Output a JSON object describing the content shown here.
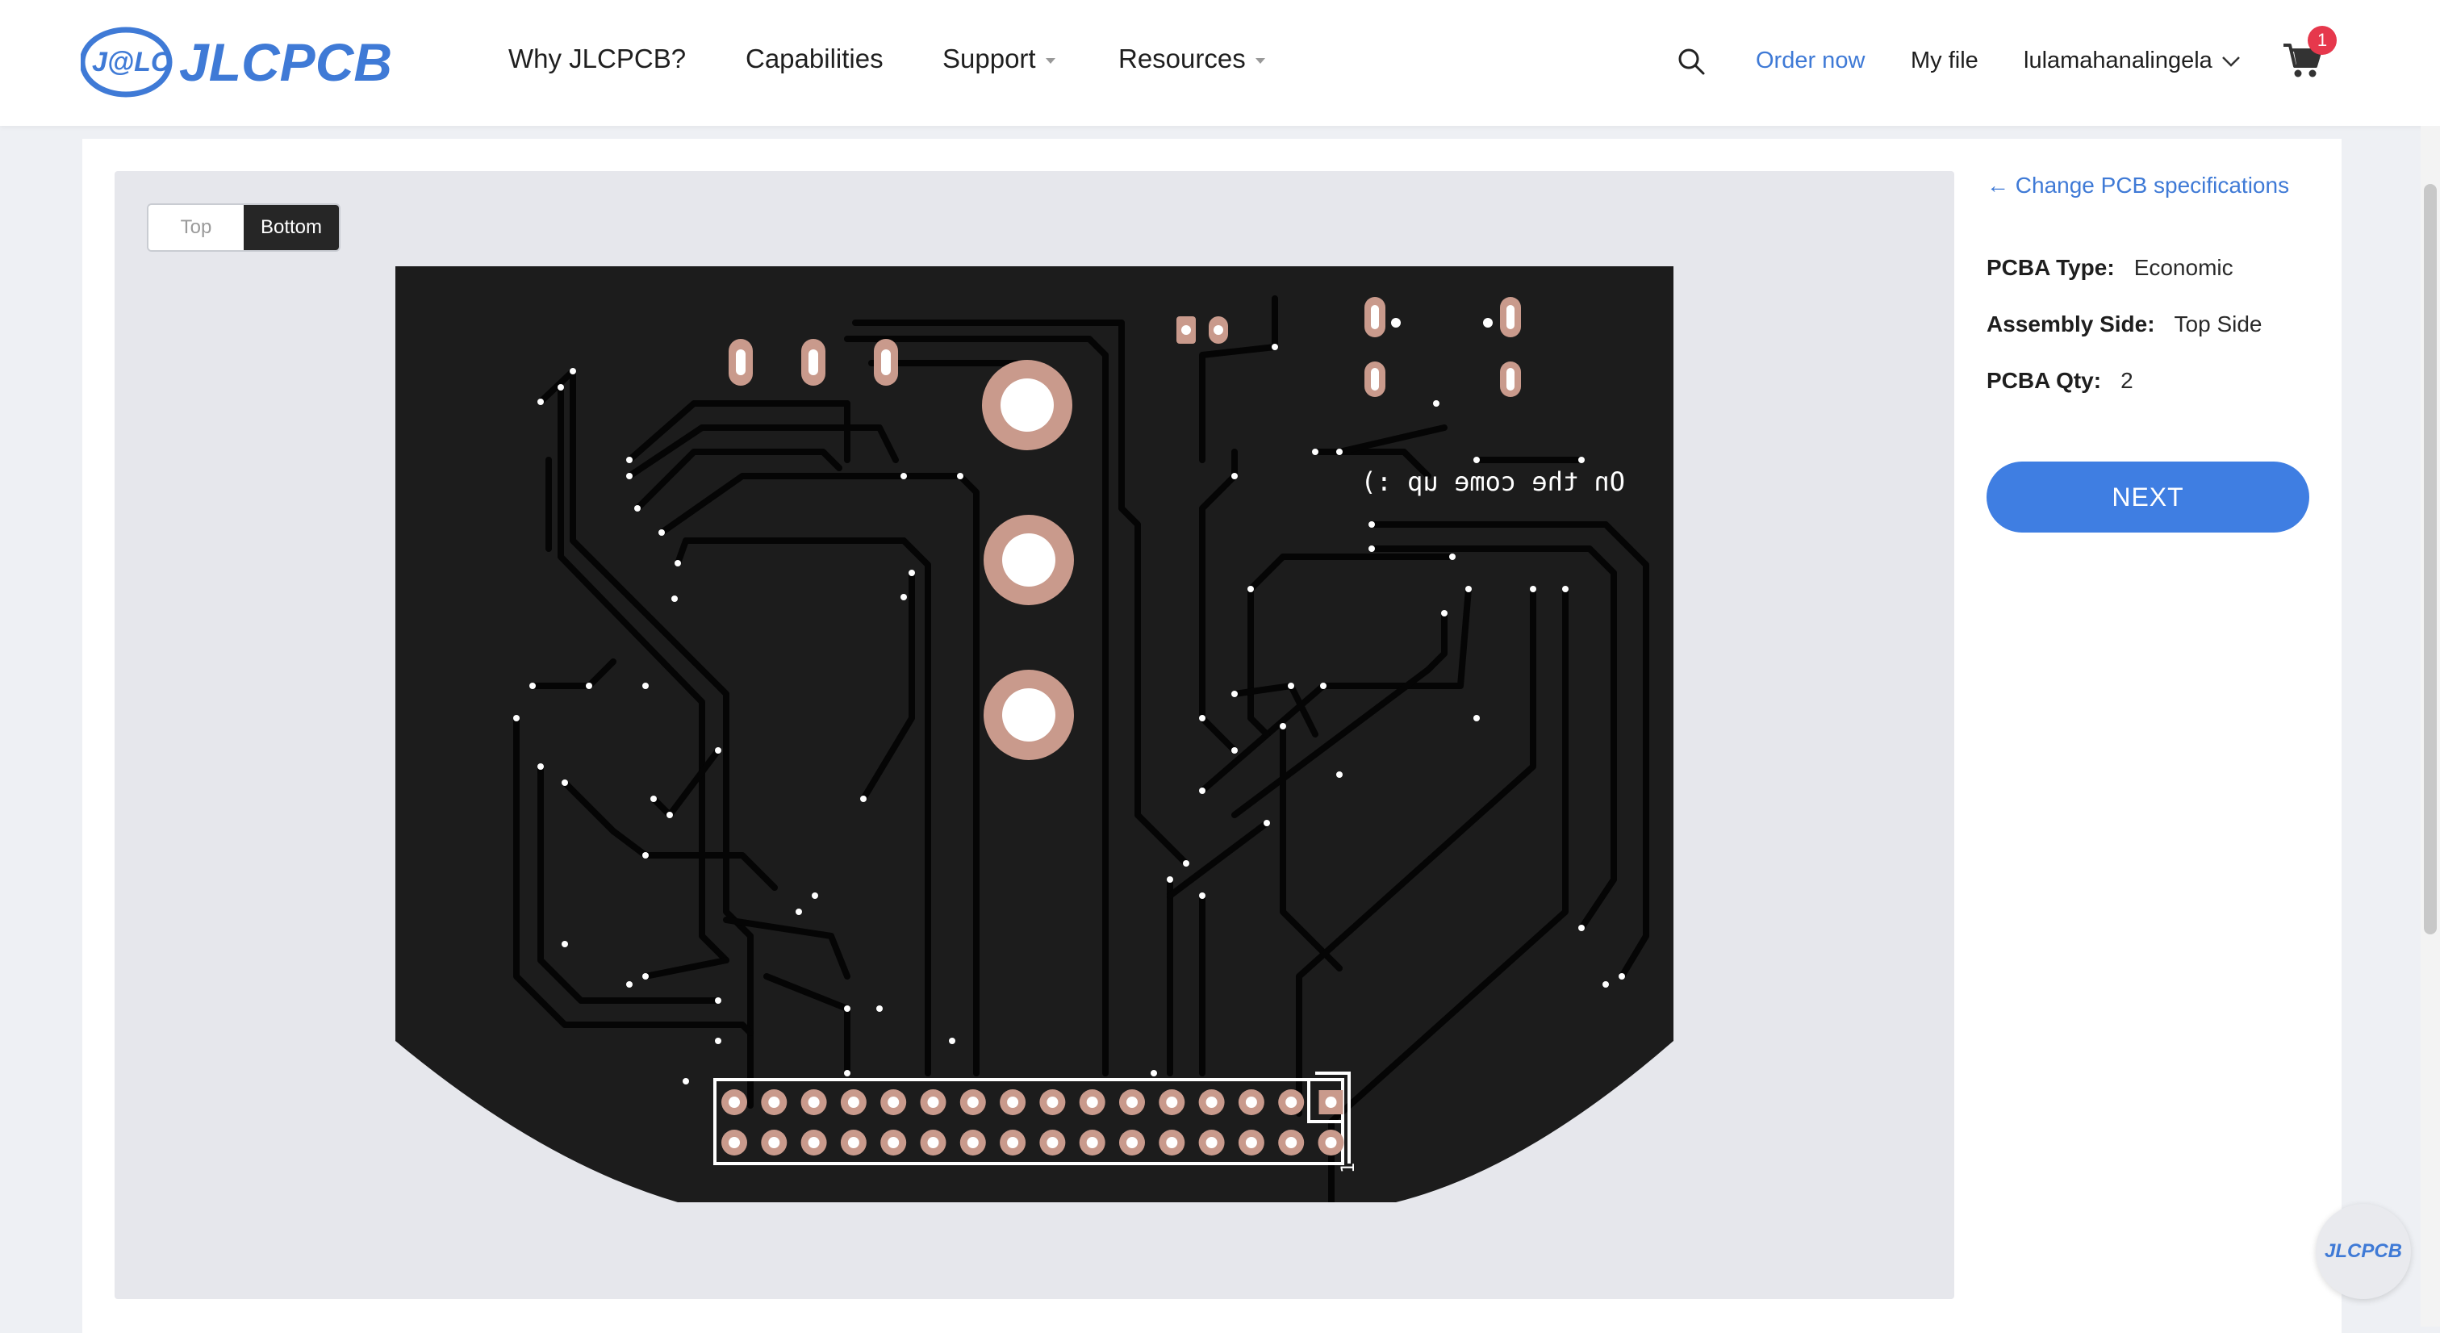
{
  "header": {
    "logo_text": "JLCPCB",
    "logo_badge": "J@LC",
    "nav": [
      {
        "label": "Why JLCPCB?",
        "dropdown": false
      },
      {
        "label": "Capabilities",
        "dropdown": false
      },
      {
        "label": "Support",
        "dropdown": true
      },
      {
        "label": "Resources",
        "dropdown": true
      }
    ],
    "order_now": "Order now",
    "my_file": "My file",
    "username": "lulamahanalingela",
    "cart_count": "1"
  },
  "viewer": {
    "toggle": {
      "top": "Top",
      "bottom": "Bottom",
      "active": "Bottom"
    },
    "silkscreen_text": "On the come up :)",
    "connector_label": "1"
  },
  "panel": {
    "back_link": "← Change PCB specifications",
    "specs": [
      {
        "key": "PCBA Type:",
        "value": "Economic"
      },
      {
        "key": "Assembly Side:",
        "value": "Top Side"
      },
      {
        "key": "PCBA Qty:",
        "value": "2"
      }
    ],
    "next_label": "NEXT"
  },
  "floating_badge": "JLCPCB",
  "colors": {
    "accent": "#3f7ee2",
    "link": "#3f7ad6",
    "badge": "#e6384c",
    "pcb_board": "#1c1c1c",
    "pcb_trace": "#050505",
    "pcb_pad": "#c99a8c"
  }
}
